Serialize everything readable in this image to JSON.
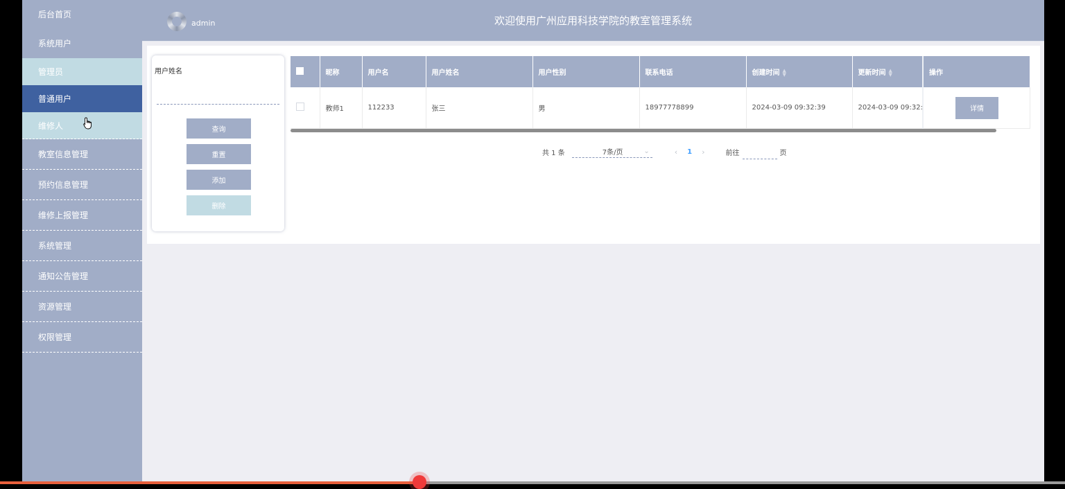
{
  "sidebar": {
    "items": [
      {
        "label": "后台首页"
      },
      {
        "label": "系统用户"
      },
      {
        "label": "管理员"
      },
      {
        "label": "普通用户"
      },
      {
        "label": "维修人"
      },
      {
        "label": "教室信息管理"
      },
      {
        "label": "预约信息管理"
      },
      {
        "label": "维修上报管理"
      },
      {
        "label": "系统管理"
      },
      {
        "label": "通知公告管理"
      },
      {
        "label": "资源管理"
      },
      {
        "label": "权限管理"
      }
    ]
  },
  "header": {
    "user": "admin",
    "title": "欢迎使用广州应用科技学院的教室管理系统"
  },
  "search": {
    "field_label": "用户姓名",
    "field_value": "",
    "buttons": {
      "query": "查询",
      "reset": "重置",
      "add": "添加",
      "delete": "删除"
    }
  },
  "table": {
    "columns": [
      "昵称",
      "用户名",
      "用户姓名",
      "用户性别",
      "联系电话",
      "创建时间",
      "更新时间",
      "操作"
    ],
    "rows": [
      {
        "nickname": "教师1",
        "username": "112233",
        "realname": "张三",
        "gender": "男",
        "phone": "18977778899",
        "created": "2024-03-09 09:32:39",
        "updated": "2024-03-09 09:32:3",
        "action": "详情"
      }
    ]
  },
  "pagination": {
    "total": "共 1 条",
    "page_size": "7条/页",
    "current_page": "1",
    "goto_label": "前往",
    "page_suffix": "页",
    "goto_value": ""
  },
  "icons": {
    "sort": "sort-caret-icon",
    "cursor": "hand-pointer-icon",
    "avatar": "loading-spinner-avatar"
  },
  "colors": {
    "sidebar": "#a1adc7",
    "active": "#3f61a0",
    "light": "#c1dbe3",
    "progress": "#e8603c"
  },
  "progress": {
    "fraction": 0.394
  }
}
